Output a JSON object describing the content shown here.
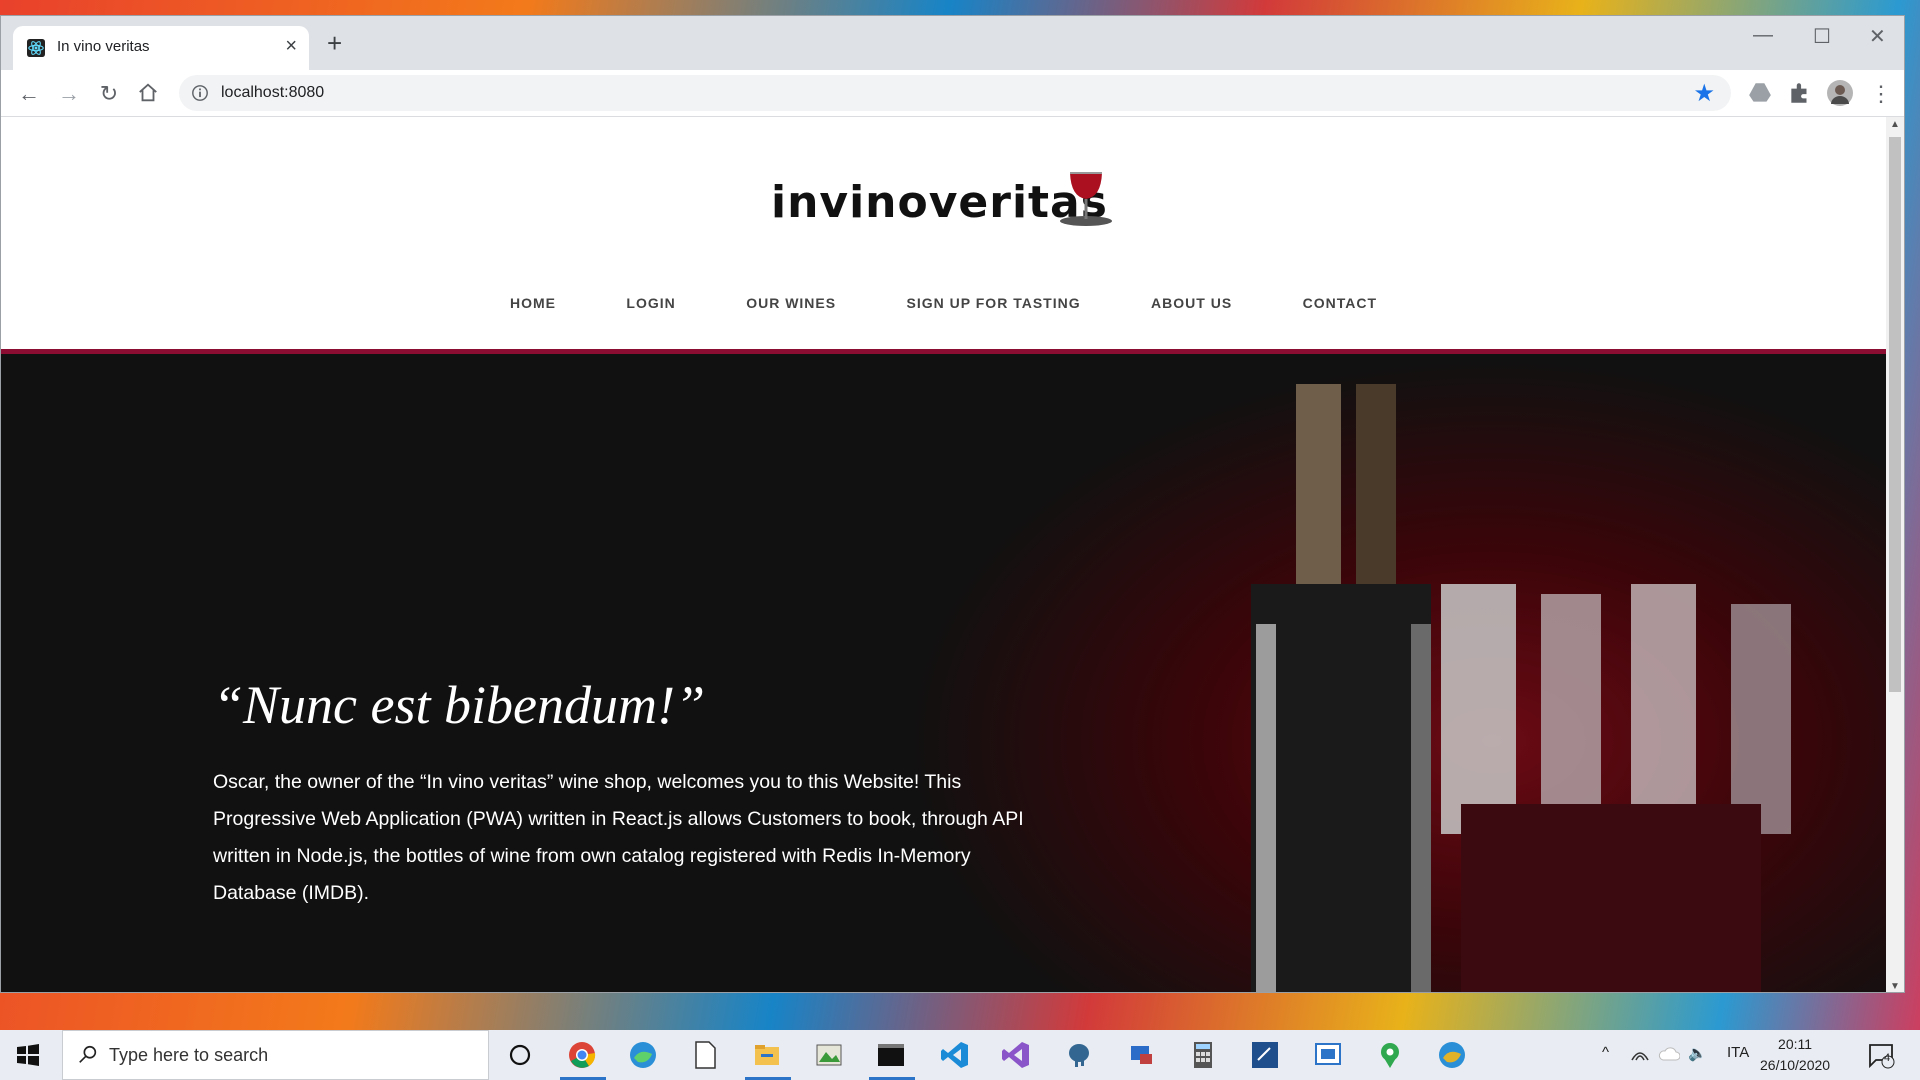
{
  "browser": {
    "tab_title": "In vino veritas",
    "tab_close": "×",
    "new_tab": "+",
    "url": "localhost:8080",
    "window_controls": {
      "minimize": "—",
      "maximize": "☐",
      "close": "✕"
    }
  },
  "site": {
    "logo_text": "invinoveritas",
    "nav": [
      "HOME",
      "LOGIN",
      "OUR WINES",
      "SIGN UP FOR TASTING",
      "ABOUT US",
      "CONTACT"
    ],
    "hero_title": "“Nunc est bibendum!”",
    "hero_text": "Oscar, the owner of the “In vino veritas” wine shop, welcomes you to this Website! This Progressive Web Application (PWA) written in React.js allows Customers to book, through API written in Node.js, the bottles of wine from own catalog registered with Redis In-Memory Database (IMDB)."
  },
  "taskbar": {
    "search_placeholder": "Type here to search",
    "language": "ITA",
    "time": "20:11",
    "date": "26/10/2020",
    "notification_count": "4"
  },
  "colors": {
    "accent_bar": "#8b0d32",
    "hero_bg": "#111111",
    "star": "#1a73e8"
  }
}
